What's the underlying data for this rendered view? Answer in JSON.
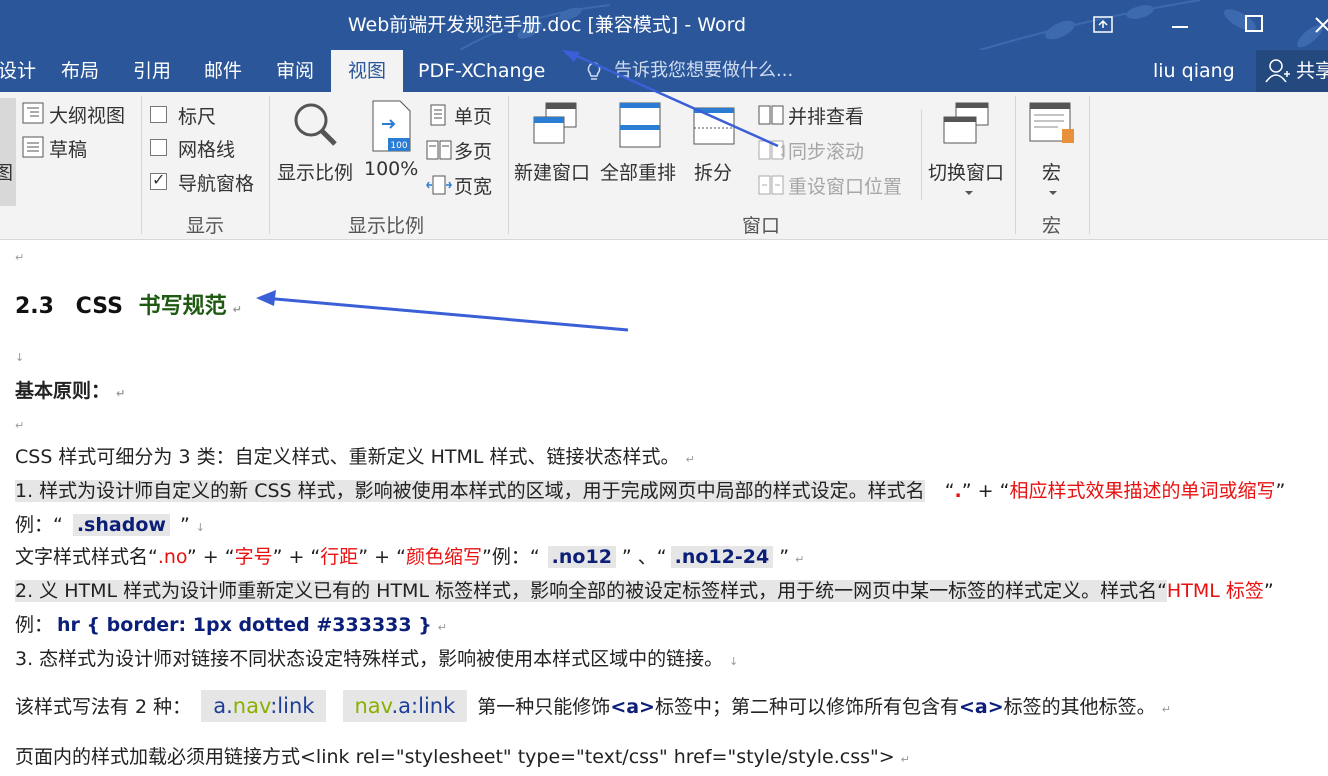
{
  "window": {
    "title": "Web前端开发规范手册.doc [兼容模式] - Word"
  },
  "tabs": [
    {
      "label": "设计"
    },
    {
      "label": "布局"
    },
    {
      "label": "引用"
    },
    {
      "label": "邮件"
    },
    {
      "label": "审阅"
    },
    {
      "label": "视图"
    },
    {
      "label": "PDF-XChange"
    }
  ],
  "tell_me": {
    "placeholder": "告诉我您想要做什么..."
  },
  "user": {
    "name": "liu qiang",
    "share_label": "共享"
  },
  "ribbon": {
    "views": {
      "outline": "大纲视图",
      "draft": "草稿",
      "cut_label": "图"
    },
    "show": {
      "ruler": "标尺",
      "ruler_checked": false,
      "gridlines": "网格线",
      "gridlines_checked": false,
      "nav_pane": "导航窗格",
      "nav_pane_checked": true,
      "group_label": "显示"
    },
    "zoom": {
      "zoom_label": "显示比例",
      "percent_label": "100%",
      "percent_icon_text": "100",
      "one_page": "单页",
      "multi_page": "多页",
      "page_width": "页宽",
      "group_label": "显示比例"
    },
    "window": {
      "new_window": "新建窗口",
      "arrange_all": "全部重排",
      "split": "拆分",
      "side_by_side": "并排查看",
      "sync_scroll": "同步滚动",
      "reset_position": "重设窗口位置",
      "switch_windows": "切换窗口",
      "group_label": "窗口"
    },
    "macros": {
      "label": "宏",
      "group_label": "宏"
    }
  },
  "document": {
    "heading_num": "2.3",
    "heading_css": "CSS",
    "heading_cn": "书写规范",
    "basic_principle": "基本原则：",
    "p1": "CSS 样式可细分为 3 类：自定义样式、重新定义 HTML 样式、链接状态样式。",
    "p2_prefix": "1. 样式为设计师自定义的新 CSS 样式，影响被使用本样式的区域，用于完成网页中局部的样式设定。样式名",
    "p2_q1": "“",
    "p2_dot": ".",
    "p2_q2": "”",
    "p2_plus": " + “",
    "p2_red": "相应样式效果描述的单词或缩写",
    "p2_end": "”",
    "p3_prefix": "例：“",
    "p3_code": ".shadow",
    "p3_suffix": "”",
    "p4_prefix": "文字样式样式名“",
    "p4_no": ".no",
    "p4_a": "” + “",
    "p4_size": "字号",
    "p4_b": "” + “",
    "p4_spacing": "行距",
    "p4_c": "” + “",
    "p4_color": "颜色缩写",
    "p4_d": "”例：“",
    "p4_code1": ".no12",
    "p4_e": "” 、“",
    "p4_code2": ".no12-24",
    "p4_f": "”",
    "p5_prefix": "2. 义 HTML 样式为设计师重新定义已有的 HTML 标签样式，影响全部的被设定标签样式，用于统一网页中某一标签的样式定义。样式名“",
    "p5_red": "HTML 标签",
    "p5_end": "”",
    "p6_prefix": "例：",
    "p6_code": "hr { border: 1px dotted #333333 }",
    "p7": "3. 态样式为设计师对链接不同状态设定特殊样式，影响被使用本样式区域中的链接。",
    "p8_prefix": "该样式写法有 2 种：",
    "p8_code1_a": "a.",
    "p8_code1_b": "nav",
    "p8_code1_c": ":link",
    "p8_code2_a": "nav",
    "p8_code2_b": ".a:link",
    "p8_mid": "第一种只能修饰",
    "p8_tag1": "<a>",
    "p8_mid2": "标签中；第二种可以修饰所有包含有",
    "p8_tag2": "<a>",
    "p8_end": "标签的其他标签。",
    "p9": "页面内的样式加载必须用链接方式<link rel=\"stylesheet\" type=\"text/css\" href=\"style/style.css\">"
  },
  "icons": [
    "outline-view-icon",
    "draft-icon",
    "zoom-magnifier-icon",
    "zoom-100-icon",
    "one-page-icon",
    "multi-page-icon",
    "page-width-icon",
    "new-window-icon",
    "arrange-all-icon",
    "split-icon",
    "side-by-side-icon",
    "sync-scroll-icon",
    "reset-window-icon",
    "switch-windows-icon",
    "macros-icon",
    "lightbulb-icon",
    "user-icon",
    "restore-icon",
    "minimize-icon",
    "maximize-icon",
    "close-icon"
  ],
  "colors": {
    "word_blue": "#2b579a",
    "ribbon_bg": "#f3f3f3",
    "heading_green": "#1e5a12",
    "annotation_arrow": "#3a5fd6",
    "red_text": "#e81010",
    "code_navy": "#0b1f78"
  }
}
